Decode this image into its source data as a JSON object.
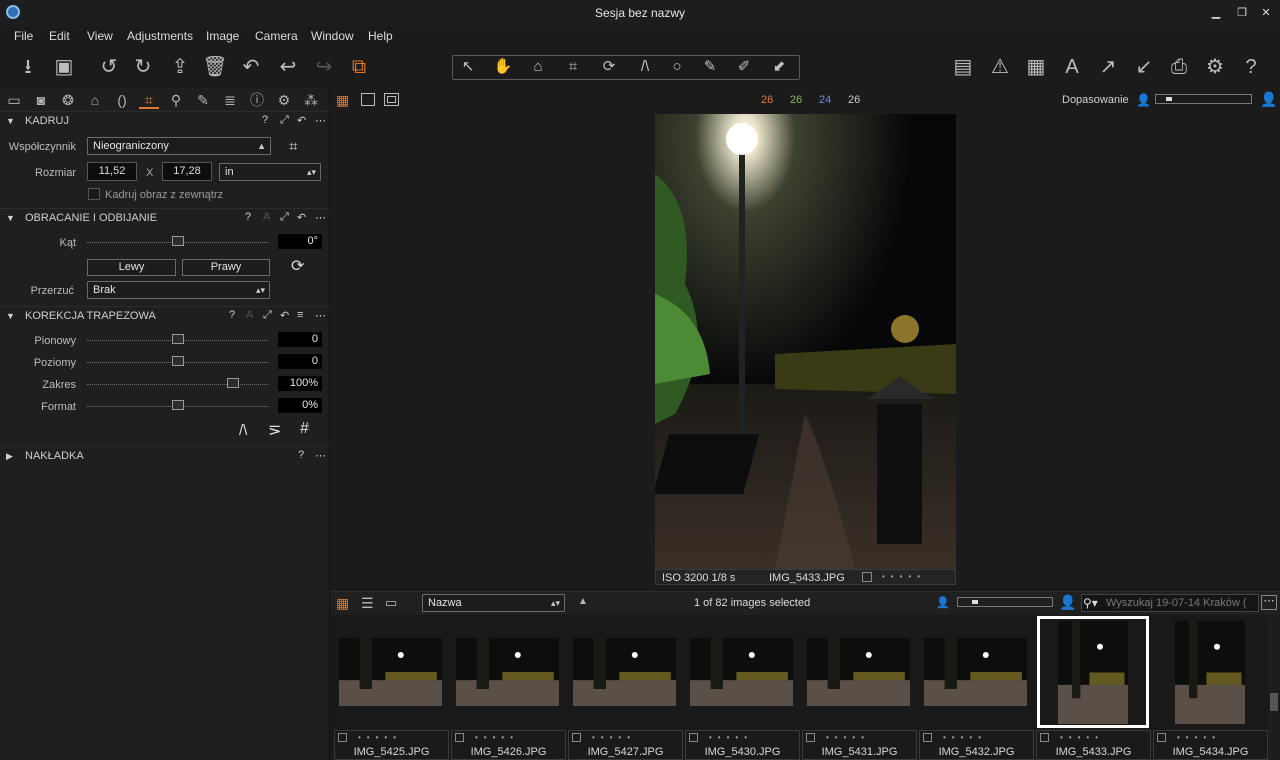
{
  "window": {
    "title": "Sesja bez nazwy"
  },
  "menu": [
    "File",
    "Edit",
    "View",
    "Adjustments",
    "Image",
    "Camera",
    "Window",
    "Help"
  ],
  "left_tabs": [
    "folder-icon",
    "camera-icon",
    "color-icon",
    "exposure-icon",
    "lens-icon",
    "crop-icon",
    "search-icon",
    "brush-icon",
    "metadata-icon",
    "info-icon",
    "settings-icon",
    "styles-icon"
  ],
  "crop": {
    "title": "KADRUJ",
    "ratio_label": "Współczynnik",
    "ratio_value": "Nieograniczony",
    "size_label": "Rozmiar",
    "width": "11,52",
    "x": "X",
    "height": "17,28",
    "unit": "in",
    "outside_label": "Kadruj obraz z zewnątrz",
    "outside_checked": false
  },
  "rotation": {
    "title": "OBRACANIE I ODBIJANIE",
    "angle_label": "Kąt",
    "angle_value": "0°",
    "angle_level": 0.5,
    "left_label": "Lewy",
    "right_label": "Prawy",
    "flip_label": "Przerzuć",
    "flip_value": "Brak"
  },
  "keystone": {
    "title": "KOREKCJA TRAPEZOWA",
    "rows": [
      {
        "label": "Pionowy",
        "value": "0",
        "level": 0.5
      },
      {
        "label": "Poziomy",
        "value": "0",
        "level": 0.5
      },
      {
        "label": "Zakres",
        "value": "100%",
        "level": 0.8
      },
      {
        "label": "Format",
        "value": "0%",
        "level": 0.5
      }
    ]
  },
  "overlay": {
    "title": "NAKŁADKA"
  },
  "viewer": {
    "counts": [
      {
        "value": "26",
        "color": "#e07a3a"
      },
      {
        "value": "26",
        "color": "#7ec24d"
      },
      {
        "value": "24",
        "color": "#6f86e8"
      },
      {
        "value": "26",
        "color": "#c8c8c8"
      }
    ],
    "fit_label": "Dopasowanie",
    "caption_exposure": "ISO 3200 1/8 s",
    "caption_file": "IMG_5433.JPG",
    "stars": "•••••"
  },
  "browser": {
    "sort_value": "Nazwa",
    "selection": "1 of 82 images selected",
    "search_placeholder": "Wyszukaj 19-07-14 Kraków ("
  },
  "thumbnails": [
    {
      "name": "IMG_5425.JPG"
    },
    {
      "name": "IMG_5426.JPG"
    },
    {
      "name": "IMG_5427.JPG"
    },
    {
      "name": "IMG_5430.JPG"
    },
    {
      "name": "IMG_5431.JPG"
    },
    {
      "name": "IMG_5432.JPG"
    },
    {
      "name": "IMG_5433.JPG",
      "selected": true,
      "portrait": true
    },
    {
      "name": "IMG_5434.JPG",
      "portrait": true
    }
  ],
  "colors": {
    "accent": "#e07a2a",
    "bg": "#1b1b1b"
  }
}
